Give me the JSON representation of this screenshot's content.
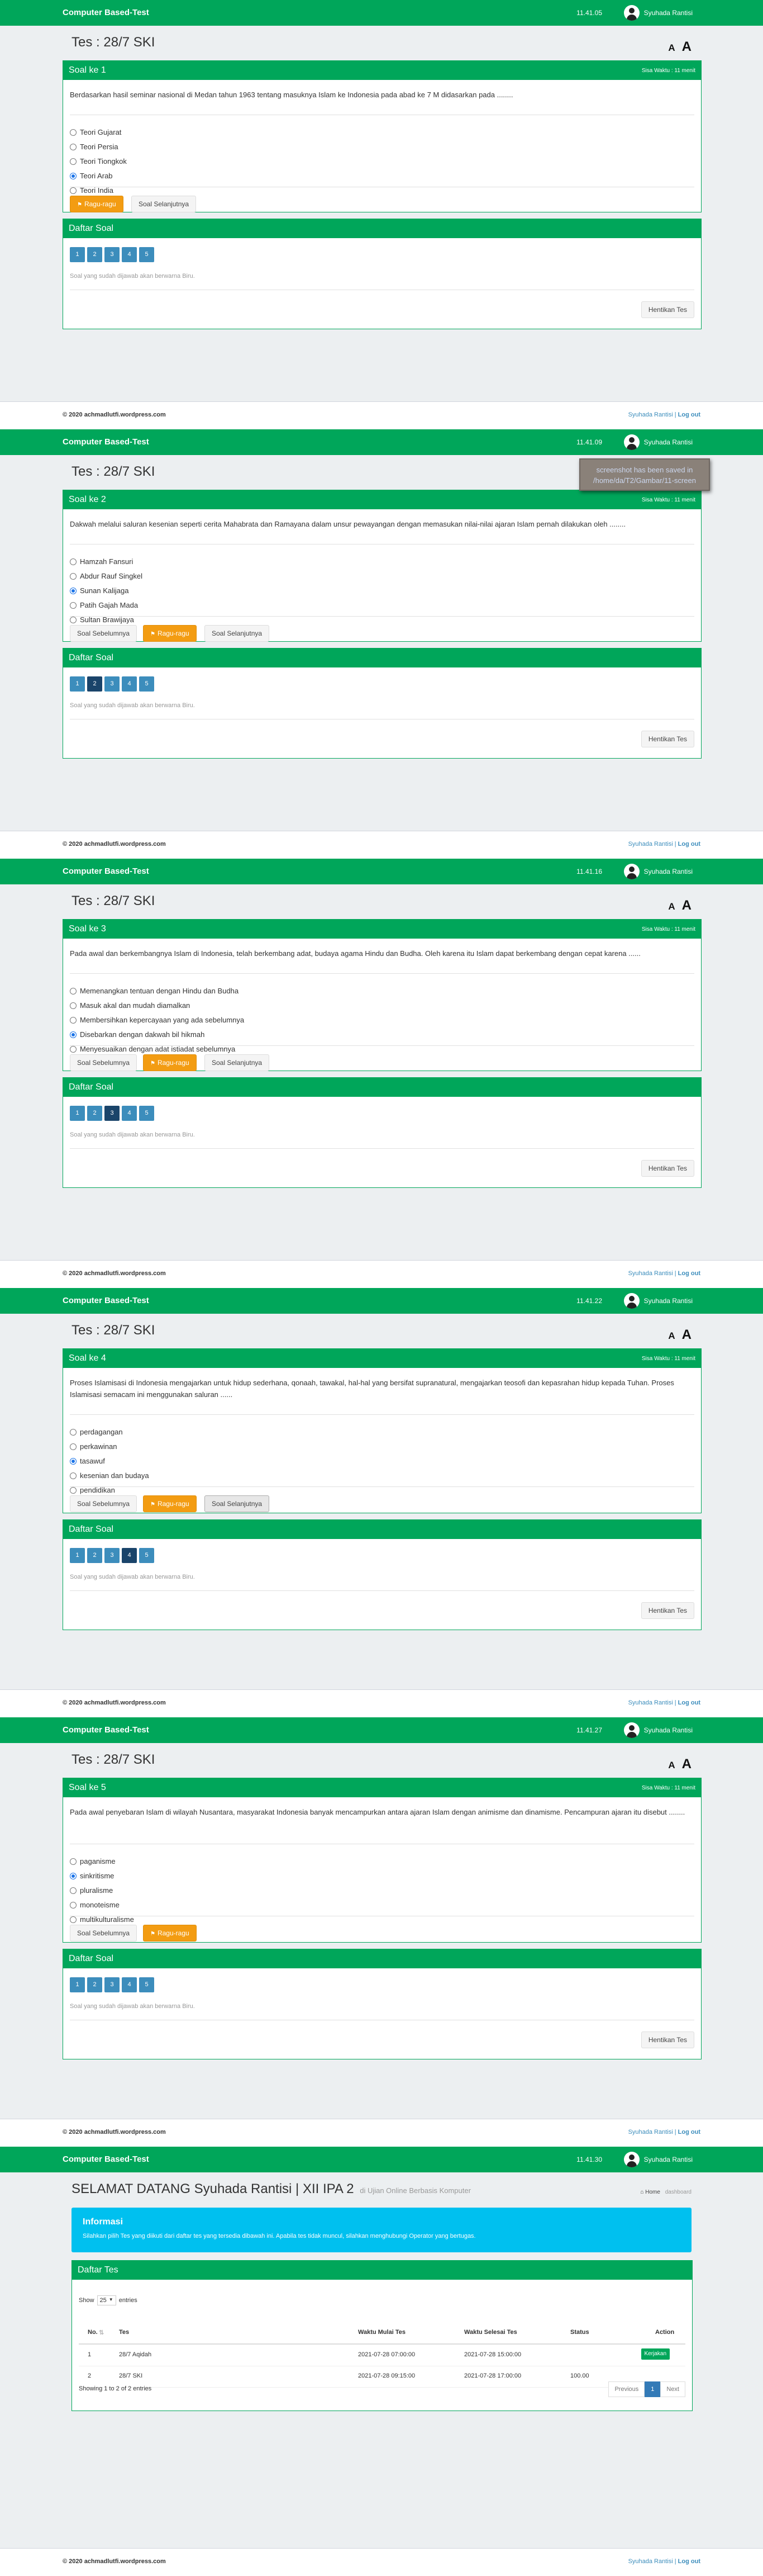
{
  "brand": "Computer Based-Test",
  "user_name": "Syuhada Rantisi",
  "footer": {
    "copyright": "© 2020 achmadlutfi.wordpress.com",
    "user": "Syuhada Rantisi",
    "sep": " | ",
    "logout": "Log out"
  },
  "exam": {
    "title": "Tes : 28/7 SKI",
    "font_small": "A",
    "font_large": "A",
    "timer": "Sisa Waktu : 11 menit",
    "daftar_soal": "Daftar Soal",
    "hint": "Soal yang sudah dijawab akan berwarna Biru.",
    "stop": "Hentikan Tes",
    "btn_prev": "Soal Sebelumnya",
    "btn_doubt": "Ragu-ragu",
    "btn_next": "Soal Selanjutnya",
    "numbers": [
      "1",
      "2",
      "3",
      "4",
      "5"
    ]
  },
  "frames": [
    {
      "clock": "11.41.05",
      "label": "Soal ke 1",
      "question": "Berdasarkan hasil seminar nasional di Medan tahun 1963 tentang masuknya Islam ke Indonesia pada abad ke 7 M didasarkan pada ........",
      "options": [
        "Teori Gujarat",
        "Teori Persia",
        "Teori Tiongkok",
        "Teori Arab",
        "Teori India"
      ],
      "selected": 3,
      "current": null
    },
    {
      "clock": "11.41.09",
      "label": "Soal ke 2",
      "question": "Dakwah melalui saluran kesenian seperti cerita Mahabrata dan Ramayana dalam unsur pewayangan dengan memasukan nilai-nilai ajaran Islam pernah dilakukan oleh ........",
      "options": [
        "Hamzah Fansuri",
        "Abdur Rauf Singkel",
        "Sunan Kalijaga",
        "Patih Gajah Mada",
        "Sultan Brawijaya"
      ],
      "selected": 2,
      "current": 1
    },
    {
      "clock": "11.41.16",
      "label": "Soal ke 3",
      "question": "Pada awal dan berkembangnya Islam di Indonesia, telah berkembang adat, budaya agama Hindu dan Budha. Oleh karena itu Islam dapat berkembang dengan cepat karena ......",
      "options": [
        "Memenangkan tentuan dengan Hindu dan Budha",
        "Masuk akal dan mudah diamalkan",
        "Membersihkan kepercayaan yang ada sebelumnya",
        "Disebarkan dengan dakwah bil hikmah",
        "Menyesuaikan dengan adat istiadat sebelumnya"
      ],
      "selected": 3,
      "current": 2
    },
    {
      "clock": "11.41.22",
      "label": "Soal ke 4",
      "question": "Proses Islamisasi di Indonesia mengajarkan untuk hidup sederhana, qonaah, tawakal, hal-hal yang bersifat supranatural, mengajarkan teosofi dan kepasrahan hidup kepada Tuhan. Proses Islamisasi semacam ini menggunakan saluran ......",
      "options": [
        "perdagangan",
        "perkawinan",
        "tasawuf",
        "kesenian dan budaya",
        "pendidikan"
      ],
      "selected": 2,
      "current": 3
    },
    {
      "clock": "11.41.27",
      "label": "Soal ke 5",
      "question": "Pada awal penyebaran Islam di wilayah Nusantara, masyarakat Indonesia banyak mencampurkan antara ajaran Islam dengan animisme dan dinamisme. Pencampuran ajaran itu disebut ........",
      "options": [
        "paganisme",
        "sinkritisme",
        "pluralisme",
        "monoteisme",
        "multikulturalisme"
      ],
      "selected": 1,
      "current": null
    }
  ],
  "toast": "screenshot has been saved in /home/da/T2/Gambar/11-screen",
  "dashboard": {
    "clock": "11.41.30",
    "welcome": "SELAMAT DATANG Syuhada Rantisi | XII IPA 2",
    "subtitle": "di Ujian Online Berbasis Komputer",
    "crumb_home": "Home",
    "crumb_current": "dashboard",
    "info_title": "Informasi",
    "info_text": "Silahkan pilih Tes yang diikuti dari daftar tes yang tersedia dibawah ini. Apabila tes tidak muncul, silahkan menghubungi Operator yang bertugas.",
    "table_title": "Daftar Tes",
    "show": "Show",
    "entries_value": "25",
    "entries": "entries",
    "columns": [
      "No.",
      "Tes",
      "Waktu Mulai Tes",
      "Waktu Selesai Tes",
      "Status",
      "Action"
    ],
    "rows": [
      {
        "no": "1",
        "tes": "28/7 Aqidah",
        "mulai": "2021-07-28 07:00:00",
        "selesai": "2021-07-28 15:00:00",
        "status": "",
        "action": "Kerjakan"
      },
      {
        "no": "2",
        "tes": "28/7 SKI",
        "mulai": "2021-07-28 09:15:00",
        "selesai": "2021-07-28 17:00:00",
        "status": "100.00",
        "action": ""
      }
    ],
    "showing": "Showing 1 to 2 of 2 entries",
    "prev": "Previous",
    "page": "1",
    "next": "Next"
  }
}
